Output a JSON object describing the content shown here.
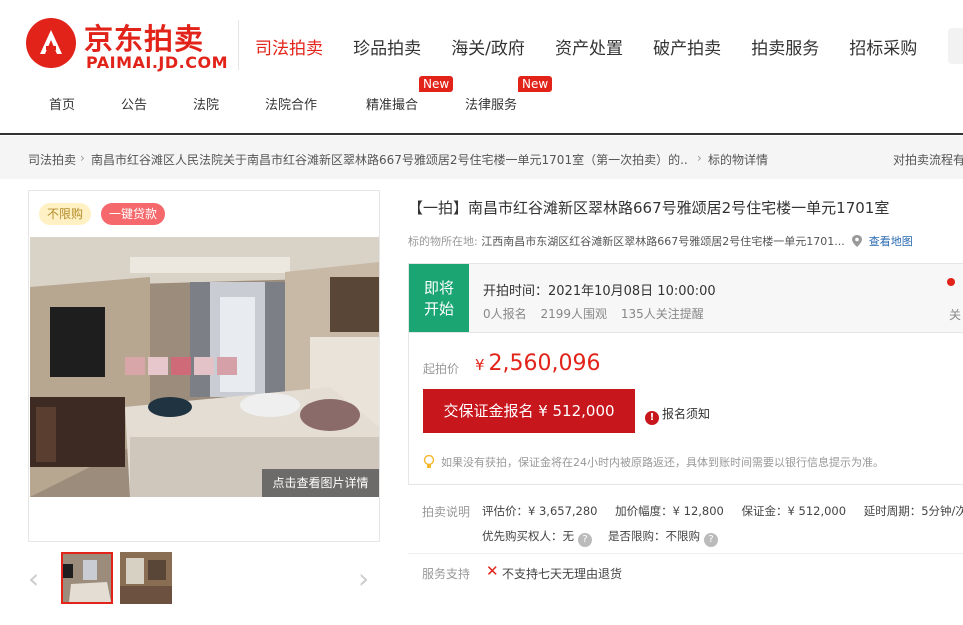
{
  "logo": {
    "cn": "京东拍卖",
    "en": "PAIMAI.JD.COM"
  },
  "mainnav": [
    "司法拍卖",
    "珍品拍卖",
    "海关/政府",
    "资产处置",
    "破产拍卖",
    "拍卖服务",
    "招标采购"
  ],
  "subnav": {
    "items": [
      "首页",
      "公告",
      "法院",
      "法院合作",
      "精准撮合",
      "法律服务"
    ],
    "badge": "New"
  },
  "breadcrumb": {
    "root": "司法拍卖",
    "middle": "南昌市红谷滩区人民法院关于南昌市红谷滩新区翠林路667号雅颂居2号住宅楼一单元1701室（第一次拍卖）的...",
    "current": "标的物详情",
    "right": "对拍卖流程有"
  },
  "gallery": {
    "tag_limit": "不限购",
    "tag_loan": "一键贷款",
    "detail_button": "点击查看图片详情",
    "prev": "‹",
    "next": "›"
  },
  "item": {
    "title": "【一拍】南昌市红谷滩新区翠林路667号雅颂居2号住宅楼一单元1701室",
    "location_label": "标的物所在地:",
    "location_value": "江西南昌市东湖区红谷滩新区翠林路667号雅颂居2号住宅楼一单元1701...",
    "map_link": "查看地图"
  },
  "status": {
    "line1": "即将",
    "line2": "开始",
    "start_time": "开拍时间：2021年10月08日 10:00:00",
    "signups": "0人报名",
    "views": "2199人围观",
    "watchers": "135人关注提醒",
    "edge_text": "关"
  },
  "price": {
    "start_label": "起拍价",
    "currency": "¥",
    "start_value": "2,560,096",
    "bid_button": "交保证金报名 ¥ 512,000",
    "notice": "报名须知",
    "tip": "如果没有获拍，保证金将在24小时内被原路返还，具体到账时间需要以银行信息提示为准。"
  },
  "description": {
    "label": "拍卖说明",
    "appraisal": "评估价：¥ 3,657,280",
    "increment": "加价幅度：¥ 12,800",
    "deposit": "保证金：¥ 512,000",
    "delay": "延时周期：5分钟/次",
    "priority": "优先购买权人：无",
    "limit": "是否限购：不限购"
  },
  "service": {
    "label": "服务支持",
    "value": "不支持七天无理由退货"
  },
  "colors": {
    "brand": "#e2231a",
    "status_green": "#1aa572",
    "bid_button": "#c8161d"
  }
}
